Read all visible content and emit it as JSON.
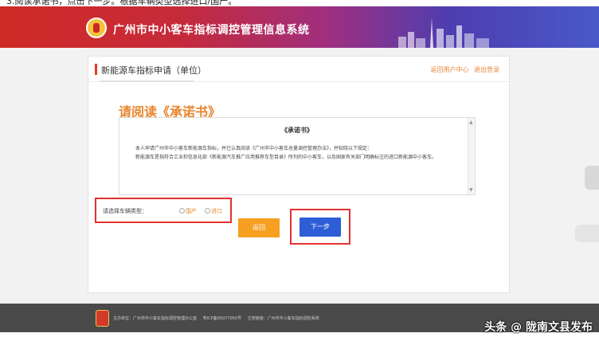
{
  "caption": "3.阅读承诺书，点击下一步。根据车辆类型选择进口/国产。",
  "header": {
    "system_title": "广州市中小客车指标调控管理信息系统"
  },
  "panel": {
    "title": "新能源车指标申请（单位）",
    "links": [
      "返回用户中心",
      "退出登录"
    ]
  },
  "promise": {
    "read_title": "请阅读《承诺书》",
    "heading": "《承诺书》",
    "para1": "本人申请广州市中小客车新能源车指标，并已认真阅读《广州市中小客车总量调控管理办法》，并知晓以下规定：",
    "para2": "新能源车是指符合工业和信息化部《新能源汽车推广应用推荐车型目录》所列的中小客车，以及国家有关部门明确标注的进口新能源中小客车。"
  },
  "vehicle_type": {
    "label": "请选择车辆类型：",
    "options": [
      "国产",
      "进口"
    ]
  },
  "buttons": {
    "back": "返回",
    "next": "下一步"
  },
  "footer": {
    "texts": [
      "主办单位：广州市中小客车指标调控管理办公室",
      "粤ICP备05077050号",
      "主管链接：广州市中小客车指标调控系统"
    ]
  },
  "watermark": "头条 @ 陇南文县发布",
  "colors": {
    "banner_start": "#cf2a26",
    "banner_end": "#4a59c8",
    "accent_orange": "#e8852b",
    "highlight_red": "#e23030",
    "next_blue": "#2d5ed6",
    "back_orange": "#f5a020"
  }
}
